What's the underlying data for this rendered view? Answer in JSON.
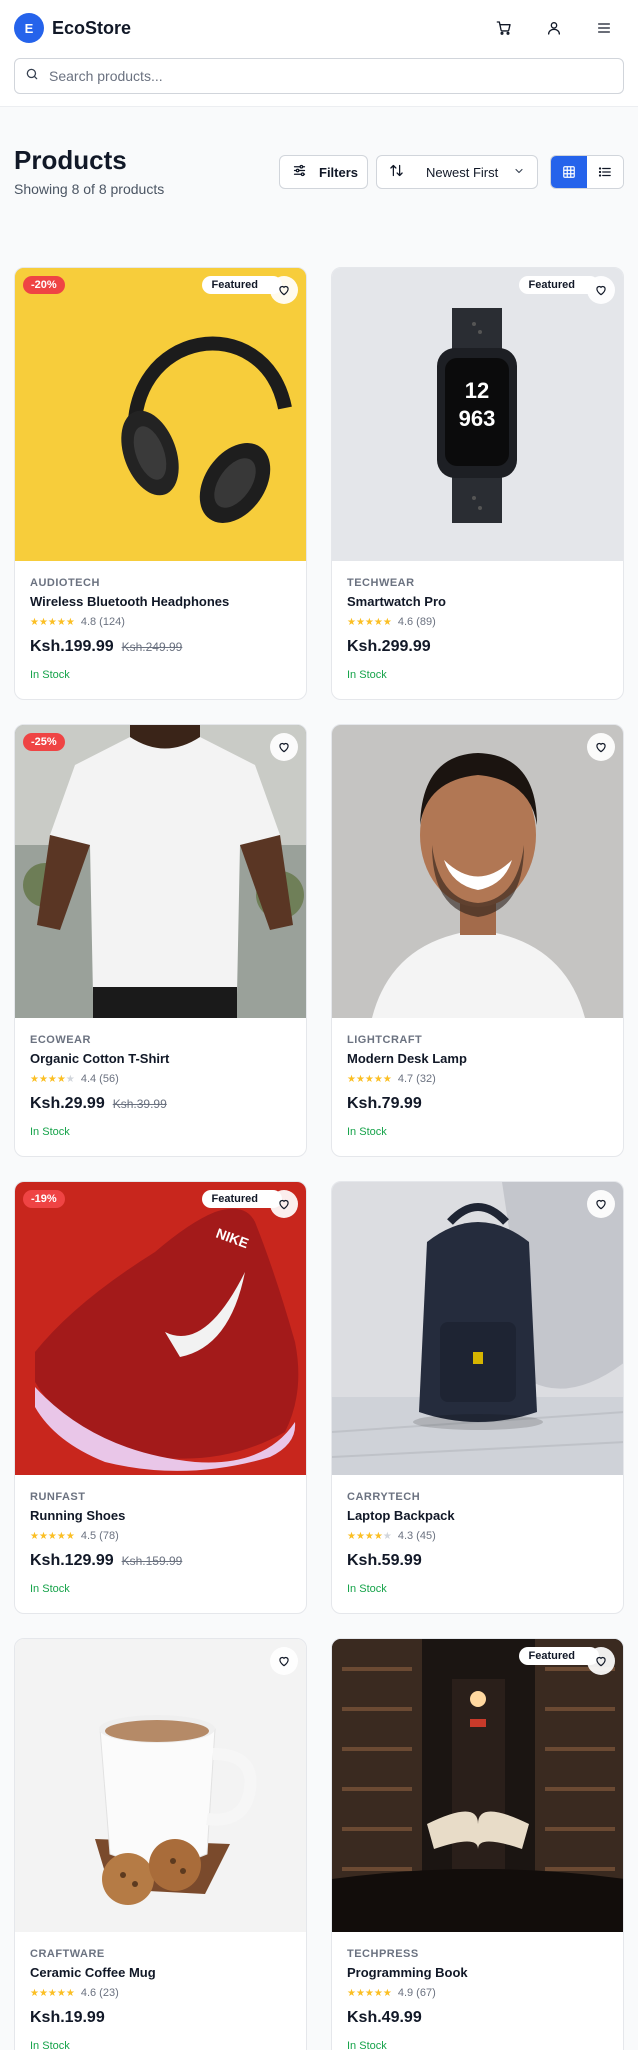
{
  "header": {
    "logo_letter": "E",
    "brand": "EcoStore"
  },
  "search": {
    "placeholder": "Search products..."
  },
  "page": {
    "title": "Products",
    "subtitle": "Showing 8 of 8 products"
  },
  "controls": {
    "filters_label": "Filters",
    "sort_value": "Newest First"
  },
  "products": [
    {
      "brand": "AUDIOTECH",
      "name": "Wireless Bluetooth Headphones",
      "rating": "4.8 (124)",
      "stars": 5,
      "price": "Ksh.199.99",
      "old_price": "Ksh.249.99",
      "stock": "In Stock",
      "discount": "-20%",
      "featured": "Featured"
    },
    {
      "brand": "TECHWEAR",
      "name": "Smartwatch Pro",
      "rating": "4.6 (89)",
      "stars": 5,
      "price": "Ksh.299.99",
      "old_price": "",
      "stock": "In Stock",
      "discount": "",
      "featured": "Featured"
    },
    {
      "brand": "ECOWEAR",
      "name": "Organic Cotton T-Shirt",
      "rating": "4.4 (56)",
      "stars": 4,
      "price": "Ksh.29.99",
      "old_price": "Ksh.39.99",
      "stock": "In Stock",
      "discount": "-25%",
      "featured": ""
    },
    {
      "brand": "LIGHTCRAFT",
      "name": "Modern Desk Lamp",
      "rating": "4.7 (32)",
      "stars": 5,
      "price": "Ksh.79.99",
      "old_price": "",
      "stock": "In Stock",
      "discount": "",
      "featured": ""
    },
    {
      "brand": "RUNFAST",
      "name": "Running Shoes",
      "rating": "4.5 (78)",
      "stars": 5,
      "price": "Ksh.129.99",
      "old_price": "Ksh.159.99",
      "stock": "In Stock",
      "discount": "-19%",
      "featured": "Featured"
    },
    {
      "brand": "CARRYTECH",
      "name": "Laptop Backpack",
      "rating": "4.3 (45)",
      "stars": 4,
      "price": "Ksh.59.99",
      "old_price": "",
      "stock": "In Stock",
      "discount": "",
      "featured": ""
    },
    {
      "brand": "CRAFTWARE",
      "name": "Ceramic Coffee Mug",
      "rating": "4.6 (23)",
      "stars": 5,
      "price": "Ksh.19.99",
      "old_price": "",
      "stock": "In Stock",
      "discount": "",
      "featured": ""
    },
    {
      "brand": "TECHPRESS",
      "name": "Programming Book",
      "rating": "4.9 (67)",
      "stars": 5,
      "price": "Ksh.49.99",
      "old_price": "",
      "stock": "In Stock",
      "discount": "",
      "featured": "Featured"
    }
  ],
  "colors": {
    "primary": "#2563eb",
    "discount": "#ef4444",
    "stock": "#16a34a",
    "star": "#fbbf24"
  }
}
